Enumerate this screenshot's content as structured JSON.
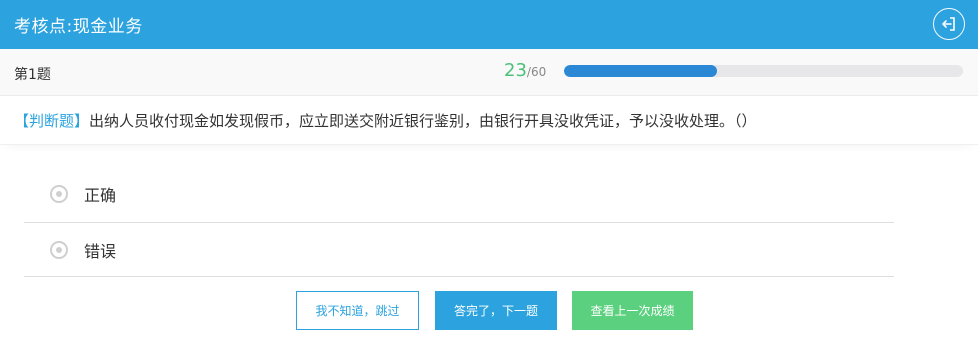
{
  "header": {
    "title": "考核点:现金业务",
    "exit_icon": "exit-icon"
  },
  "progress": {
    "question_label": "第1题",
    "current": "23",
    "total": "/60",
    "completed_fraction": 0.383,
    "colors": {
      "count": "#4cc07a",
      "fill": "#2b88d5",
      "track": "#e7e7e9"
    }
  },
  "question": {
    "type": "【判断题】",
    "text": "出纳人员收付现金如发现假币，应立即送交附近银行鉴别，由银行开具没收凭证，予以没收处理。（）"
  },
  "options": [
    {
      "label": "正确"
    },
    {
      "label": "错误"
    }
  ],
  "buttons": {
    "skip": "我不知道，跳过",
    "next": "答完了，下一题",
    "last_score": "查看上一次成绩"
  },
  "colors": {
    "primary": "#2ca3df",
    "green": "#5bd07f"
  }
}
